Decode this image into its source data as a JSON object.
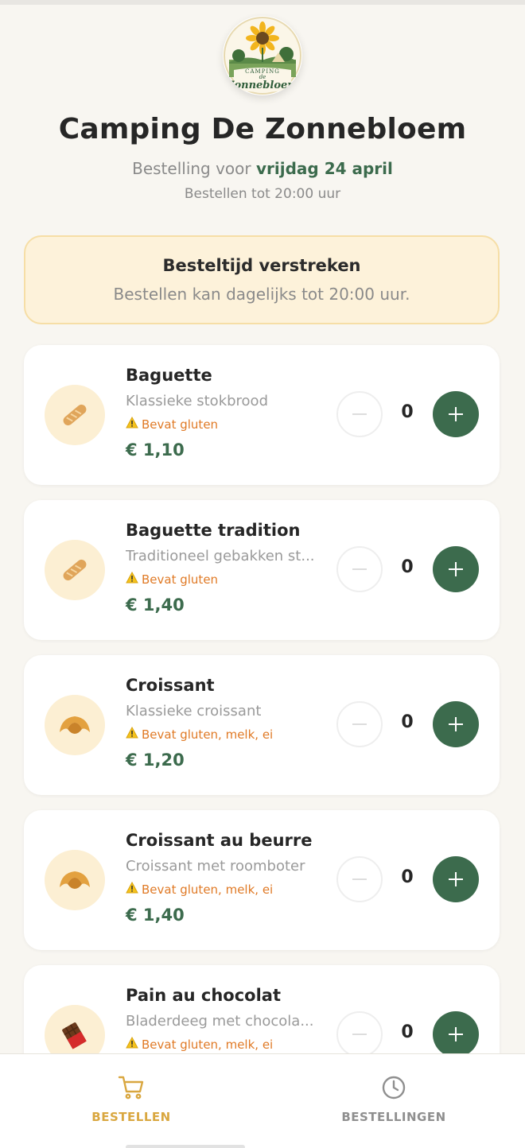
{
  "header": {
    "logo_top": "CAMPING",
    "logo_mid": "de",
    "logo_name": "Zonnebloem",
    "title": "Camping De Zonnebloem",
    "subtitle_prefix": "Bestelling voor ",
    "subtitle_date": "vrijdag 24 april",
    "deadline": "Bestellen tot 20:00 uur"
  },
  "notice": {
    "title": "Besteltijd verstreken",
    "text": "Bestellen kan dagelijks tot 20:00 uur."
  },
  "products": [
    {
      "name": "Baguette",
      "desc": "Klassieke stokbrood",
      "allergen": "Bevat gluten",
      "price": "€ 1,10",
      "qty": "0",
      "icon": "baguette-icon"
    },
    {
      "name": "Baguette tradition",
      "desc": "Traditioneel gebakken st...",
      "allergen": "Bevat gluten",
      "price": "€ 1,40",
      "qty": "0",
      "icon": "baguette-icon"
    },
    {
      "name": "Croissant",
      "desc": "Klassieke croissant",
      "allergen": "Bevat gluten, melk, ei",
      "price": "€ 1,20",
      "qty": "0",
      "icon": "croissant-icon"
    },
    {
      "name": "Croissant au beurre",
      "desc": "Croissant met roomboter",
      "allergen": "Bevat gluten, melk, ei",
      "price": "€ 1,40",
      "qty": "0",
      "icon": "croissant-icon"
    },
    {
      "name": "Pain au chocolat",
      "desc": "Bladerdeeg met chocola...",
      "allergen": "Bevat gluten, melk, ei",
      "price": "",
      "qty": "0",
      "icon": "chocolate-icon"
    }
  ],
  "nav": {
    "order_label": "BESTELLEN",
    "orders_label": "BESTELLINGEN"
  },
  "colors": {
    "accent_green": "#3c6b4d",
    "accent_gold": "#d9a740",
    "warning_orange": "#e07a26",
    "notice_bg": "#fdf2da"
  }
}
